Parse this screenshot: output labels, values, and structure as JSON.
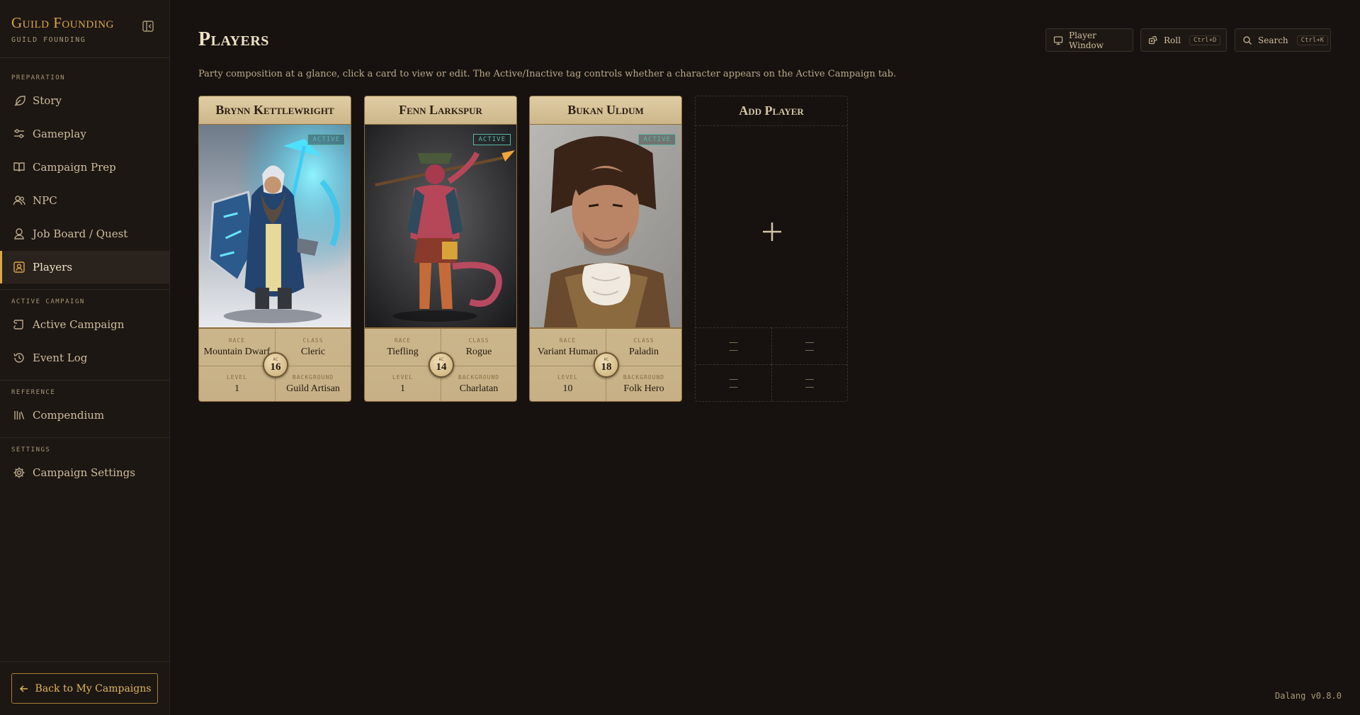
{
  "app": {
    "title": "Guild Founding",
    "subtitle": "GUILD FOUNDING"
  },
  "sidebar": {
    "sections": [
      {
        "label": "PREPARATION"
      },
      {
        "label": "ACTIVE CAMPAIGN"
      },
      {
        "label": "REFERENCE"
      },
      {
        "label": "SETTINGS"
      }
    ],
    "items": [
      {
        "label": "Story",
        "icon": "feather-icon"
      },
      {
        "label": "Gameplay",
        "icon": "sliders-icon"
      },
      {
        "label": "Campaign Prep",
        "icon": "book-icon"
      },
      {
        "label": "NPC",
        "icon": "users-icon"
      },
      {
        "label": "Job Board / Quest",
        "icon": "badge-icon"
      },
      {
        "label": "Players",
        "icon": "portrait-icon",
        "active": true
      },
      {
        "label": "Active Campaign",
        "icon": "scroll-icon"
      },
      {
        "label": "Event Log",
        "icon": "history-icon"
      },
      {
        "label": "Compendium",
        "icon": "library-icon"
      },
      {
        "label": "Campaign Settings",
        "icon": "gear-icon"
      }
    ],
    "back_label": "Back to My Campaigns"
  },
  "header": {
    "title": "Players",
    "description": "Party composition at a glance, click a card to view or edit. The Active/Inactive tag controls whether a character appears on the Active Campaign tab.",
    "buttons": {
      "player_window": "Player Window",
      "roll": "Roll",
      "roll_shortcut": "Ctrl+D",
      "search": "Search",
      "search_shortcut": "Ctrl+K"
    }
  },
  "labels": {
    "race": "RACE",
    "class": "CLASS",
    "level": "LEVEL",
    "background": "BACKGROUND",
    "ac": "AC"
  },
  "players": [
    {
      "name": "Brynn Kettlewright",
      "status": "ACTIVE",
      "race": "Mountain Dwarf",
      "class": "Cleric",
      "level": "1",
      "background": "Guild Artisan",
      "ac": "16"
    },
    {
      "name": "Fenn Larkspur",
      "status": "ACTIVE",
      "race": "Tiefling",
      "class": "Rogue",
      "level": "1",
      "background": "Charlatan",
      "ac": "14"
    },
    {
      "name": "Bukan Uldum",
      "status": "ACTIVE",
      "race": "Variant Human",
      "class": "Paladin",
      "level": "10",
      "background": "Folk Hero",
      "ac": "18"
    }
  ],
  "add_player": {
    "title": "Add Player",
    "placeholder": "—\n—"
  },
  "footer": {
    "version": "Dalang v0.8.0"
  },
  "colors": {
    "accent": "#d9a74a",
    "active_tag": "#5bb8a8",
    "background": "#17120f"
  }
}
